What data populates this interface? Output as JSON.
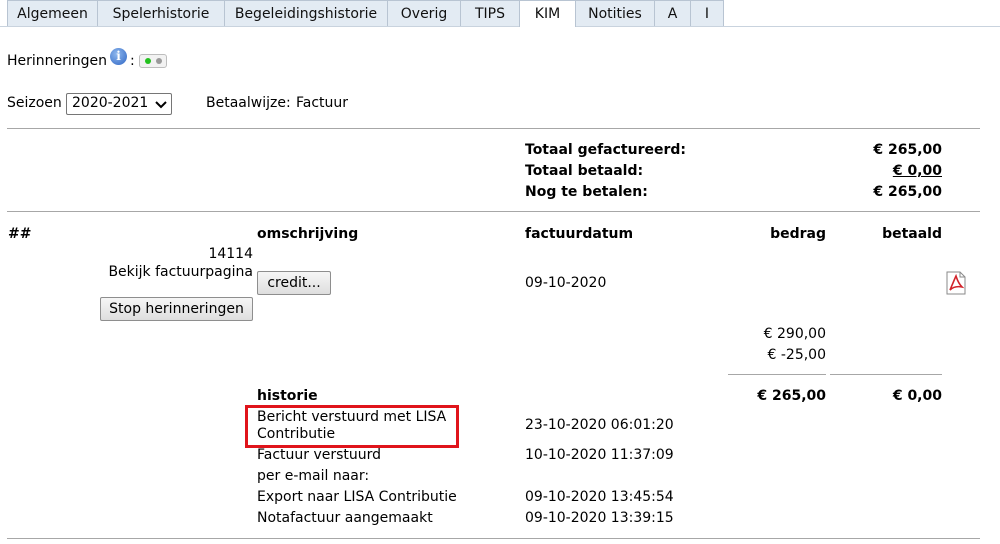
{
  "tabs": [
    "Algemeen",
    "Spelerhistorie",
    "Begeleidingshistorie",
    "Overig",
    "TIPS",
    "KIM",
    "Notities",
    "A",
    "I"
  ],
  "active_tab": "KIM",
  "reminders": {
    "label": "Herinneringen",
    "colon": ":",
    "toggle_on": true
  },
  "season": {
    "label": "Seizoen",
    "value": "2020-2021"
  },
  "payment": {
    "label": "Betaalwijze:",
    "value": "Factuur"
  },
  "totals": {
    "invoiced_label": "Totaal gefactureerd:",
    "invoiced_value": "€ 265,00",
    "paid_label": "Totaal betaald:",
    "paid_value": "€ 0,00",
    "due_label": "Nog te betalen:",
    "due_value": "€ 265,00"
  },
  "table": {
    "headers": {
      "num": "##",
      "desc": "omschrijving",
      "date": "factuurdatum",
      "amount": "bedrag",
      "paid": "betaald"
    },
    "invoice": {
      "number": "14114",
      "view_link": "Bekijk factuurpagina",
      "stop_button": "Stop herinneringen",
      "credit_button": "credit...",
      "date": "09-10-2020",
      "lines": [
        "€ 290,00",
        "€ -25,00"
      ],
      "total_amount": "€ 265,00",
      "total_paid": "€ 0,00"
    },
    "history_label": "historie",
    "history": [
      {
        "text1": "Bericht verstuurd met LISA",
        "text2": "Contributie",
        "date": "23-10-2020 06:01:20"
      },
      {
        "text1": "Factuur verstuurd",
        "text2": "per e-mail naar:",
        "date": "10-10-2020 11:37:09"
      },
      {
        "text1": "Export naar LISA Contributie",
        "date": "09-10-2020 13:45:54"
      },
      {
        "text1": "Notafactuur aangemaakt",
        "date": "09-10-2020 13:39:15"
      }
    ]
  },
  "colors": {
    "highlight": "#e0141b",
    "toggle_on": "#22c11e",
    "toggle_off": "#9a9a9a"
  }
}
